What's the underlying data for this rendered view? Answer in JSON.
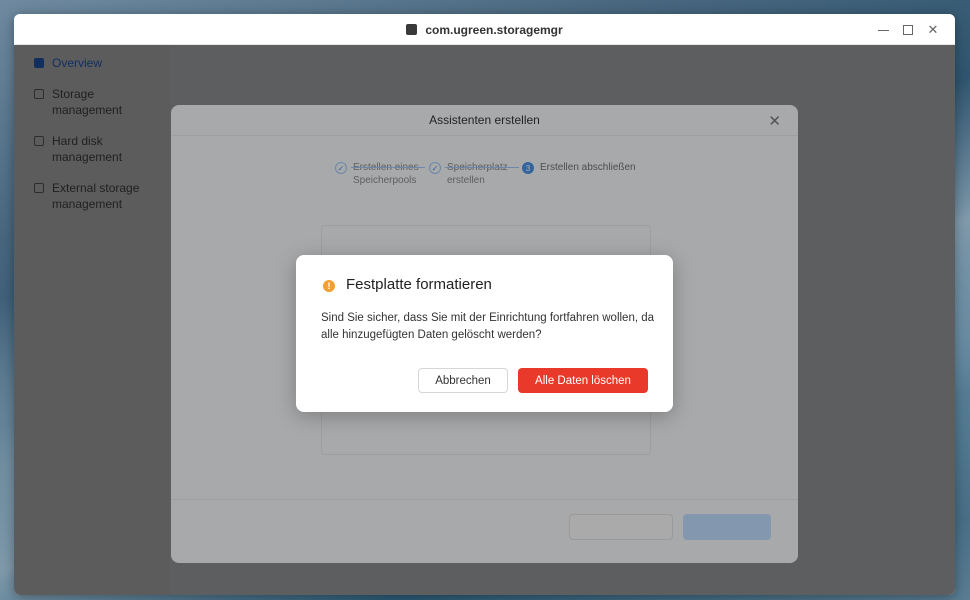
{
  "window": {
    "title": "com.ugreen.storagemgr",
    "controls": {
      "minimize_icon": "minimize-icon",
      "maximize_icon": "maximize-icon",
      "close_icon": "close-icon"
    }
  },
  "sidebar": {
    "items": [
      {
        "label": "Overview",
        "icon": "overview-icon",
        "active": true
      },
      {
        "label": "Storage management",
        "icon": "storage-icon",
        "active": false
      },
      {
        "label": "Hard disk management",
        "icon": "hard-disk-icon",
        "active": false
      },
      {
        "label": "External storage management",
        "icon": "external-storage-icon",
        "active": false
      }
    ]
  },
  "wizard": {
    "title": "Assistenten erstellen",
    "steps": [
      {
        "label": "Erstellen eines Speicherpools",
        "state": "done"
      },
      {
        "label": "Speicherplatz erstellen",
        "state": "done"
      },
      {
        "label": "Erstellen abschließen",
        "state": "current",
        "marker": "3"
      }
    ]
  },
  "dialog": {
    "title": "Festplatte formatieren",
    "icon": "warning-icon",
    "message": "Sind Sie sicher, dass Sie mit der Einrichtung fortfahren wollen, da alle hinzugefügten Daten gelöscht werden?",
    "cancel_label": "Abbrechen",
    "confirm_label": "Alle Daten löschen",
    "colors": {
      "confirm": "#e8392a",
      "warning": "#f2a032",
      "accent": "#2f7cf6"
    }
  }
}
